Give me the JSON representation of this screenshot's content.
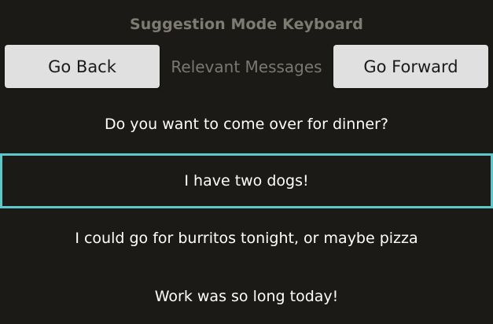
{
  "header": {
    "title": "Suggestion Mode Keyboard"
  },
  "nav": {
    "back_label": "Go Back",
    "center_label": "Relevant Messages",
    "forward_label": "Go Forward"
  },
  "messages": [
    {
      "text": "Do you want to come over for dinner?",
      "selected": false
    },
    {
      "text": "I have two dogs!",
      "selected": true
    },
    {
      "text": "I could go for burritos tonight, or maybe pizza",
      "selected": false
    },
    {
      "text": "Work was so long today!",
      "selected": false
    }
  ],
  "colors": {
    "background": "#1b1a16",
    "selection_border": "#5cc8cc",
    "button_bg": "#e0e0e0"
  }
}
